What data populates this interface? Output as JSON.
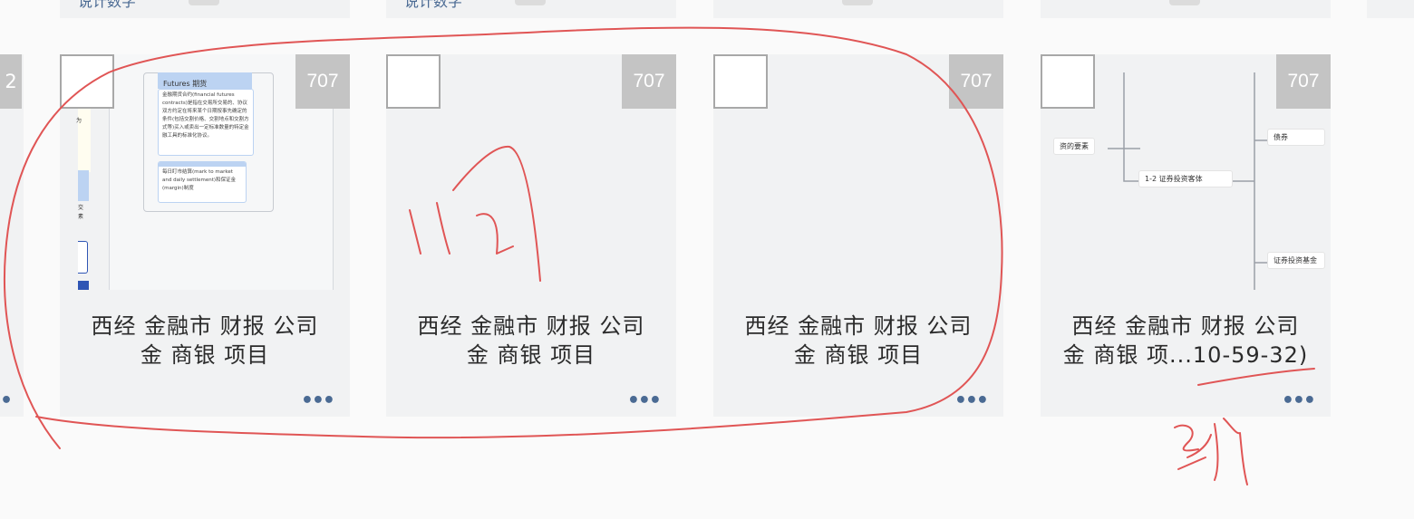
{
  "cards": [
    {
      "count": "707",
      "title_line1": "西经 金融市 财报 公司",
      "title_line2": "金 商银 项目"
    },
    {
      "count": "707",
      "title_line1": "西经 金融市 财报 公司",
      "title_line2": "金 商银 项目"
    },
    {
      "count": "707",
      "title_line1": "西经 金融市 财报 公司",
      "title_line2": "金 商银 项目"
    },
    {
      "count": "707",
      "title_line1": "西经 金融市 财报 公司",
      "title_line2": "金 商银 项...10-59-32)"
    }
  ],
  "partial_left_card": {
    "count": "2"
  },
  "more_label": "•••",
  "thumb1": {
    "header": "Futures 期货",
    "note1": "金融期货合约(financial futures contracts)是指在交易所交易的、协议双方约定在将来某个日期按事先确定的条件(包括交割价格、交割地点和交割方式等)买入或卖出一定标准数量的特定金融工具的标准化协议。",
    "note2": "每日盯市结算(mark to market and daily settlement)和保证金(margin)制度",
    "side_a": "为",
    "side_b": "交",
    "side_c": "素"
  },
  "thumb4": {
    "node_left": "资的要素",
    "node_center": "1-2 证券投资客体",
    "node_top_right": "债券",
    "node_bottom_right": "证券投资基金"
  },
  "top_row_text": "说计数字"
}
